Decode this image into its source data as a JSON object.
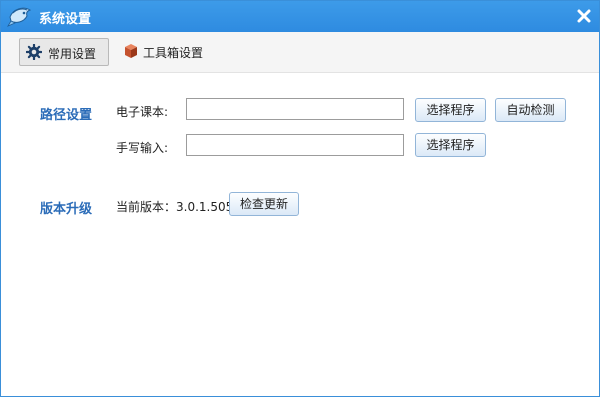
{
  "window": {
    "title": "系统设置"
  },
  "icons": {
    "app": "fish-logo-icon",
    "close": "close-icon",
    "settings": "gear-icon",
    "toolbox": "cube-icon"
  },
  "colors": {
    "titlebar": "#2e8be0",
    "section_title": "#2b6cb8",
    "button_border": "#92b5d8"
  },
  "tabs": [
    {
      "label": "常用设置",
      "active": true
    },
    {
      "label": "工具箱设置",
      "active": false
    }
  ],
  "path_settings": {
    "title": "路径设置",
    "textbook": {
      "label": "电子课本:",
      "value": "",
      "choose_label": "选择程序",
      "auto_label": "自动检测"
    },
    "handwriting": {
      "label": "手写输入:",
      "value": "",
      "choose_label": "选择程序"
    }
  },
  "version": {
    "title": "版本升级",
    "current_label": "当前版本：3.0.1.5053",
    "check_label": "检查更新"
  }
}
